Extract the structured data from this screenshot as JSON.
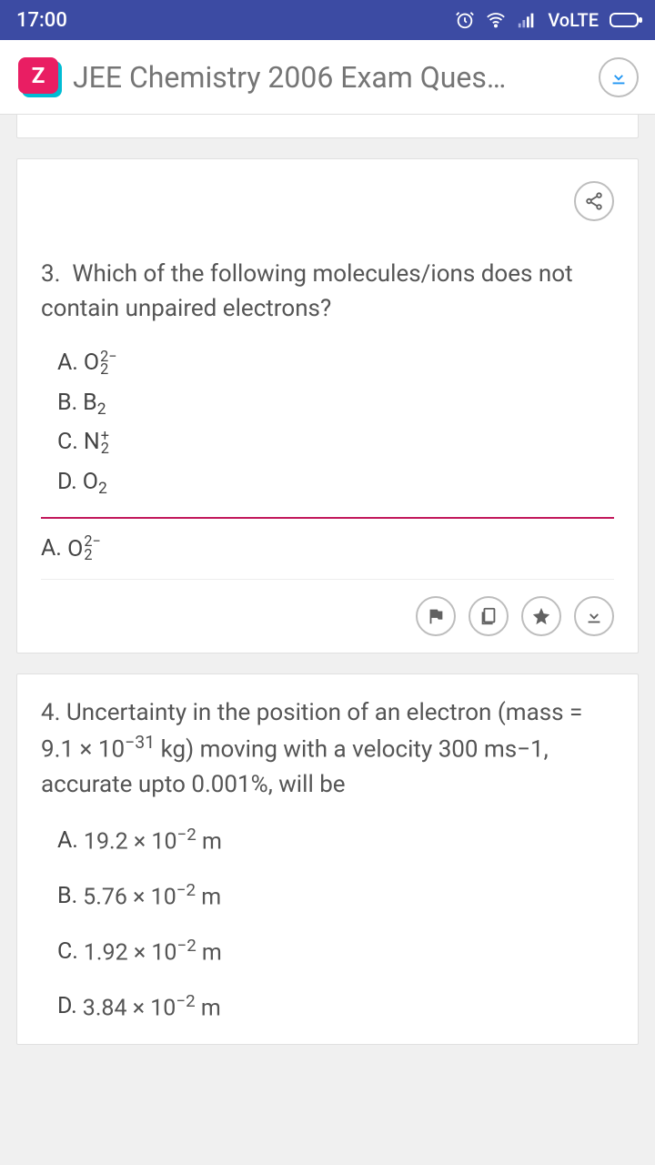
{
  "status": {
    "time": "17:00",
    "volte": "VoLTE"
  },
  "header": {
    "logo_letter": "Z",
    "title": "JEE Chemistry 2006 Exam Ques…"
  },
  "q3": {
    "number": "3.",
    "text": "Which of the following molecules/ions does not contain unpaired electrons?",
    "optA_label": "A.",
    "optA_base": "O",
    "optA_sup": "2−",
    "optA_sub": "2",
    "optB_label": "B.",
    "optB_base": "B",
    "optB_sub": "2",
    "optC_label": "C.",
    "optC_base": "N",
    "optC_sup": "+",
    "optC_sub": "2",
    "optD_label": "D.",
    "optD_base": "O",
    "optD_sub": "2",
    "answer_label": "A.",
    "answer_base": "O",
    "answer_sup": "2−",
    "answer_sub": "2"
  },
  "q4": {
    "number": "4.",
    "text_p1": "Uncertainty in the position of an electron (mass = 9.1 × 10",
    "text_exp1": "−31",
    "text_p2": " kg) moving with a velocity 300 ms−1, accurate upto 0.001%, will be",
    "optA_label": "A.",
    "optA_val": "19.2 × 10",
    "optA_exp": "−2",
    "optA_unit": " m",
    "optB_label": "B.",
    "optB_val": "5.76 × 10",
    "optB_exp": "−2",
    "optB_unit": " m",
    "optC_label": "C.",
    "optC_val": "1.92 × 10",
    "optC_exp": "−2",
    "optC_unit": " m",
    "optD_label": "D.",
    "optD_val": "3.84 × 10",
    "optD_exp": "−2",
    "optD_unit": " m"
  }
}
